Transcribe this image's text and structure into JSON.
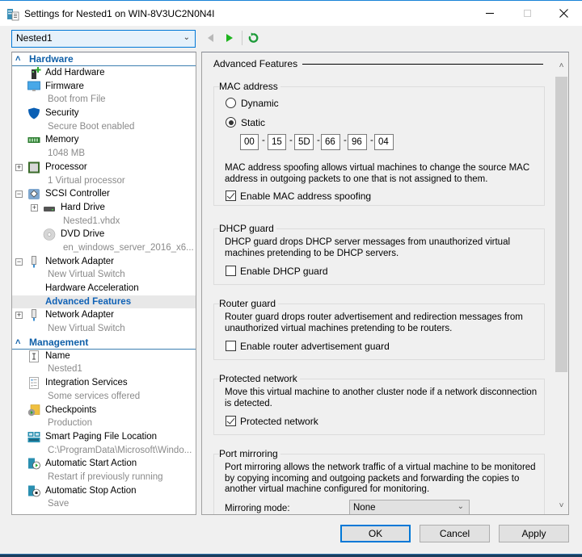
{
  "window": {
    "title": "Settings for Nested1 on WIN-8V3UC2N0N4I",
    "minimize_icon": "minimize-icon",
    "maximize_icon": "maximize-icon",
    "close_icon": "close-icon"
  },
  "toolbar": {
    "vm_selected": "Nested1",
    "back_icon": "triangle-left-icon",
    "forward_icon": "triangle-right-icon",
    "refresh_icon": "refresh-icon"
  },
  "tree": {
    "hardware_label": "Hardware",
    "management_label": "Management",
    "hardware_items": [
      {
        "label": "Add Hardware",
        "sub": "",
        "icon": "add-hardware-icon"
      },
      {
        "label": "Firmware",
        "sub": "Boot from File",
        "icon": "monitor-icon"
      },
      {
        "label": "Security",
        "sub": "Secure Boot enabled",
        "icon": "shield-icon"
      },
      {
        "label": "Memory",
        "sub": "1048 MB",
        "icon": "memory-icon"
      },
      {
        "label": "Processor",
        "sub": "1 Virtual processor",
        "icon": "processor-icon",
        "expander": "+"
      },
      {
        "label": "SCSI Controller",
        "sub": "",
        "icon": "scsi-controller-icon",
        "expander": "−"
      },
      {
        "label": "Hard Drive",
        "sub": "Nested1.vhdx",
        "icon": "hard-drive-icon",
        "expander": "+"
      },
      {
        "label": "DVD Drive",
        "sub": "en_windows_server_2016_x6...",
        "icon": "dvd-icon"
      },
      {
        "label": "Network Adapter",
        "sub": "New Virtual Switch",
        "icon": "network-adapter-icon",
        "expander": "−"
      },
      {
        "label": "Hardware Acceleration",
        "sub": ""
      },
      {
        "label": "Advanced Features",
        "sub": "",
        "selected": true
      },
      {
        "label": "Network Adapter",
        "sub": "New Virtual Switch",
        "icon": "network-adapter-icon",
        "expander": "+"
      }
    ],
    "management_items": [
      {
        "label": "Name",
        "sub": "Nested1",
        "icon": "name-icon"
      },
      {
        "label": "Integration Services",
        "sub": "Some services offered",
        "icon": "integration-services-icon"
      },
      {
        "label": "Checkpoints",
        "sub": "Production",
        "icon": "checkpoints-icon"
      },
      {
        "label": "Smart Paging File Location",
        "sub": "C:\\ProgramData\\Microsoft\\Windo...",
        "icon": "smart-paging-icon"
      },
      {
        "label": "Automatic Start Action",
        "sub": "Restart if previously running",
        "icon": "auto-start-icon"
      },
      {
        "label": "Automatic Stop Action",
        "sub": "Save",
        "icon": "auto-stop-icon"
      }
    ]
  },
  "panel": {
    "heading": "Advanced Features",
    "mac": {
      "title": "MAC address",
      "dynamic_label": "Dynamic",
      "static_label": "Static",
      "mode": "Static",
      "octets": [
        "00",
        "15",
        "5D",
        "66",
        "96",
        "04"
      ],
      "spoof_desc": "MAC address spoofing allows virtual machines to change the source MAC address in outgoing packets to one that is not assigned to them.",
      "spoof_label": "Enable MAC address spoofing",
      "spoof_checked": true
    },
    "dhcp": {
      "title": "DHCP guard",
      "desc": "DHCP guard drops DHCP server messages from unauthorized virtual machines pretending to be DHCP servers.",
      "label": "Enable DHCP guard",
      "checked": false
    },
    "router": {
      "title": "Router guard",
      "desc": "Router guard drops router advertisement and redirection messages from unauthorized virtual machines pretending to be routers.",
      "label": "Enable router advertisement guard",
      "checked": false
    },
    "protected": {
      "title": "Protected network",
      "desc": "Move this virtual machine to another cluster node if a network disconnection is detected.",
      "label": "Protected network",
      "checked": true
    },
    "mirror": {
      "title": "Port mirroring",
      "desc": "Port mirroring allows the network traffic of a virtual machine to be monitored by copying incoming and outgoing packets and forwarding the copies to another virtual machine configured for monitoring.",
      "mode_label": "Mirroring mode:",
      "mode_value": "None"
    }
  },
  "buttons": {
    "ok": "OK",
    "cancel": "Cancel",
    "apply": "Apply"
  }
}
